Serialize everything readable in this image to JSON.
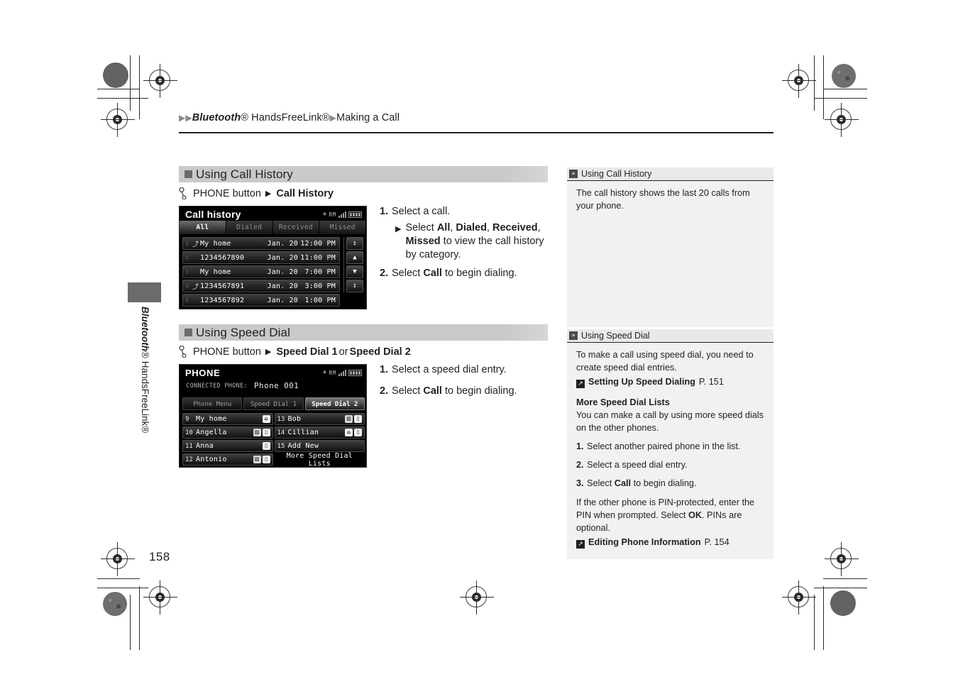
{
  "page": {
    "number": "158",
    "side_tab_label": "Bluetooth® HandsFreeLink®"
  },
  "breadcrumb": {
    "arrow1": "▶",
    "arrow2": "▶",
    "part1": "Bluetooth",
    "part1_reg": "®",
    "part2": " HandsFreeLink®",
    "arrow3": "▶",
    "part3": "Making a Call"
  },
  "sections": [
    {
      "title": "Using Call History",
      "command": {
        "icon": "phone-handset-icon",
        "prefix": "PHONE button",
        "arrow": "▶",
        "target": "Call History"
      }
    },
    {
      "title": "Using Speed Dial",
      "command": {
        "icon": "phone-handset-icon",
        "prefix": "PHONE button",
        "arrow": "▶",
        "target_a": "Speed Dial 1",
        "conjunction": " or ",
        "target_b": "Speed Dial 2"
      }
    }
  ],
  "call_history_screen": {
    "title": "Call history",
    "status": {
      "bluetooth_icon": "✳",
      "roaming": "RM"
    },
    "tabs": [
      {
        "label": "All",
        "selected": true
      },
      {
        "label": "Dialed",
        "selected": false
      },
      {
        "label": "Received",
        "selected": false
      },
      {
        "label": "Missed",
        "selected": false
      }
    ],
    "rows": [
      {
        "index": "1",
        "icon": "⤴",
        "name": "My home",
        "date": "Jan. 20",
        "time": "12:00 PM"
      },
      {
        "index": "2",
        "icon": "",
        "name": "1234567890",
        "date": "Jan. 20",
        "time": "11:00 PM"
      },
      {
        "index": "3",
        "icon": "",
        "name": "My home",
        "date": "Jan. 20",
        "time": "7:00 PM"
      },
      {
        "index": "4",
        "icon": "⤴",
        "name": "1234567891",
        "date": "Jan. 20",
        "time": "3:00 PM"
      },
      {
        "index": "5",
        "icon": "",
        "name": "1234567892",
        "date": "Jan. 20",
        "time": "1:00 PM"
      }
    ],
    "scroll_buttons": [
      "↥",
      "▲",
      "▼",
      "↧"
    ]
  },
  "call_history_steps": {
    "step1": {
      "n": "1.",
      "text": "Select a call."
    },
    "substep": {
      "arrow": "▶",
      "lead": "Select ",
      "b1": "All",
      "sep1": ", ",
      "b2": "Dialed",
      "sep2": ", ",
      "b3": "Received",
      "sep3": ",",
      "b4": "Missed",
      "tail": " to view the call history by category."
    },
    "step2": {
      "n": "2.",
      "pre": "Select ",
      "b": "Call",
      "post": " to begin dialing."
    }
  },
  "phone_screen": {
    "title": "PHONE",
    "connected_label": "CONNECTED PHONE:",
    "connected_value": "Phone 001",
    "status": {
      "bluetooth_icon": "✳",
      "roaming": "RM"
    },
    "tabs": [
      {
        "label": "Phone Menu",
        "selected": false
      },
      {
        "label": "Speed Dial 1",
        "selected": false
      },
      {
        "label": "Speed Dial 2",
        "selected": true
      }
    ],
    "entries": [
      {
        "pn": "9",
        "name": "My home",
        "badges": [
          "home"
        ]
      },
      {
        "pn": "13",
        "name": "Bob",
        "badges": [
          "work",
          "mobile"
        ]
      },
      {
        "pn": "10",
        "name": "Angella",
        "badges": [
          "work",
          "mobile"
        ]
      },
      {
        "pn": "14",
        "name": "Cillian",
        "badges": [
          "home",
          "mobile"
        ]
      },
      {
        "pn": "11",
        "name": "Anna",
        "badges": [
          "mobile"
        ]
      },
      {
        "pn": "15",
        "name": "Add New",
        "badges": []
      },
      {
        "pn": "12",
        "name": "Antonio",
        "badges": [
          "work",
          "mobile"
        ]
      },
      {
        "pn": "",
        "name": "More Speed Dial Lists",
        "badges": [],
        "plain": true
      }
    ]
  },
  "speed_dial_steps": {
    "step1": {
      "n": "1.",
      "text": "Select a speed dial entry."
    },
    "step2": {
      "n": "2.",
      "pre": "Select ",
      "b": "Call",
      "post": " to begin dialing."
    }
  },
  "aside": {
    "call_history": {
      "head_glyph": "»",
      "head": "Using Call History",
      "body": "The call history shows the last 20 calls from your phone."
    },
    "speed_dial": {
      "head_glyph": "»",
      "head": "Using Speed Dial",
      "intro": "To make a call using speed dial, you need to create speed dial entries.",
      "ref1": {
        "glyph": "↗",
        "title": "Setting Up Speed Dialing",
        "page": "P. 151"
      },
      "subhead": "More Speed Dial Lists",
      "sub_intro": "You can make a call by using more speed dials on the other phones.",
      "steps": [
        {
          "n": "1.",
          "text": "Select another paired phone in the list."
        },
        {
          "n": "2.",
          "text": "Select a speed dial entry."
        },
        {
          "n": "3.",
          "pre": "Select ",
          "b": "Call",
          "post": " to begin dialing."
        }
      ],
      "note_pre": "If the other phone is PIN-protected, enter the PIN when prompted. Select ",
      "note_b": "OK",
      "note_post": ". PINs are optional.",
      "ref2": {
        "glyph": "↗",
        "title": "Editing Phone Information",
        "page": "P. 154"
      }
    }
  },
  "colors": {
    "section_header_bg": "#c9c9c9",
    "aside_head_bg": "#e9e9e9",
    "aside_body_bg": "#f1f1f1",
    "text": "#231f20",
    "screen_bg": "#000000"
  }
}
